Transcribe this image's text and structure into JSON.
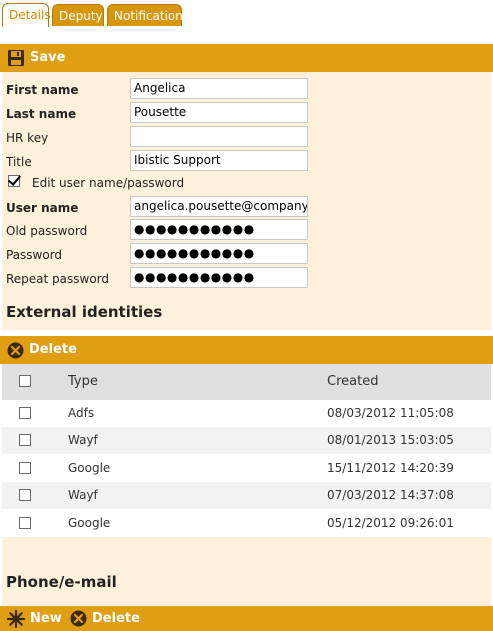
{
  "tabs": [
    {
      "label": "Details",
      "active": true
    },
    {
      "label": "Deputy",
      "active": false
    },
    {
      "label": "Notification",
      "active": false
    }
  ],
  "toolbar_top": {
    "save_label": "Save",
    "icon": "floppy-disk-icon"
  },
  "form": {
    "first_name": {
      "label": "First name",
      "value": "Angelica"
    },
    "last_name": {
      "label": "Last name",
      "value": "Pousette"
    },
    "hr_key": {
      "label": "HR key",
      "value": ""
    },
    "title": {
      "label": "Title",
      "value": "Ibistic Support"
    },
    "edit_credentials": {
      "label": "Edit user name/password",
      "checked": true
    },
    "user_name": {
      "label": "User name",
      "value": "angelica.pousette@company.c"
    },
    "old_password": {
      "label": "Old password",
      "value": "●●●●●●●●●●●"
    },
    "password": {
      "label": "Password",
      "value": "●●●●●●●●●●●"
    },
    "repeat_password": {
      "label": "Repeat password",
      "value": "●●●●●●●●●●●"
    }
  },
  "external_identities": {
    "heading": "External identities",
    "delete_label": "Delete",
    "columns": {
      "type": "Type",
      "created": "Created"
    },
    "rows": [
      {
        "type": "Adfs",
        "created": "08/03/2012 11:05:08"
      },
      {
        "type": "Wayf",
        "created": "08/01/2013 15:03:05"
      },
      {
        "type": "Google",
        "created": "15/11/2012 14:20:39"
      },
      {
        "type": "Wayf",
        "created": "07/03/2012 14:37:08"
      },
      {
        "type": "Google",
        "created": "05/12/2012 09:26:01"
      }
    ]
  },
  "phone_email": {
    "heading": "Phone/e-mail",
    "new_label": "New",
    "delete_label": "Delete"
  },
  "colors": {
    "accent": "#e09e13",
    "panel": "#fdf1dc",
    "tab": "#d8960c"
  }
}
